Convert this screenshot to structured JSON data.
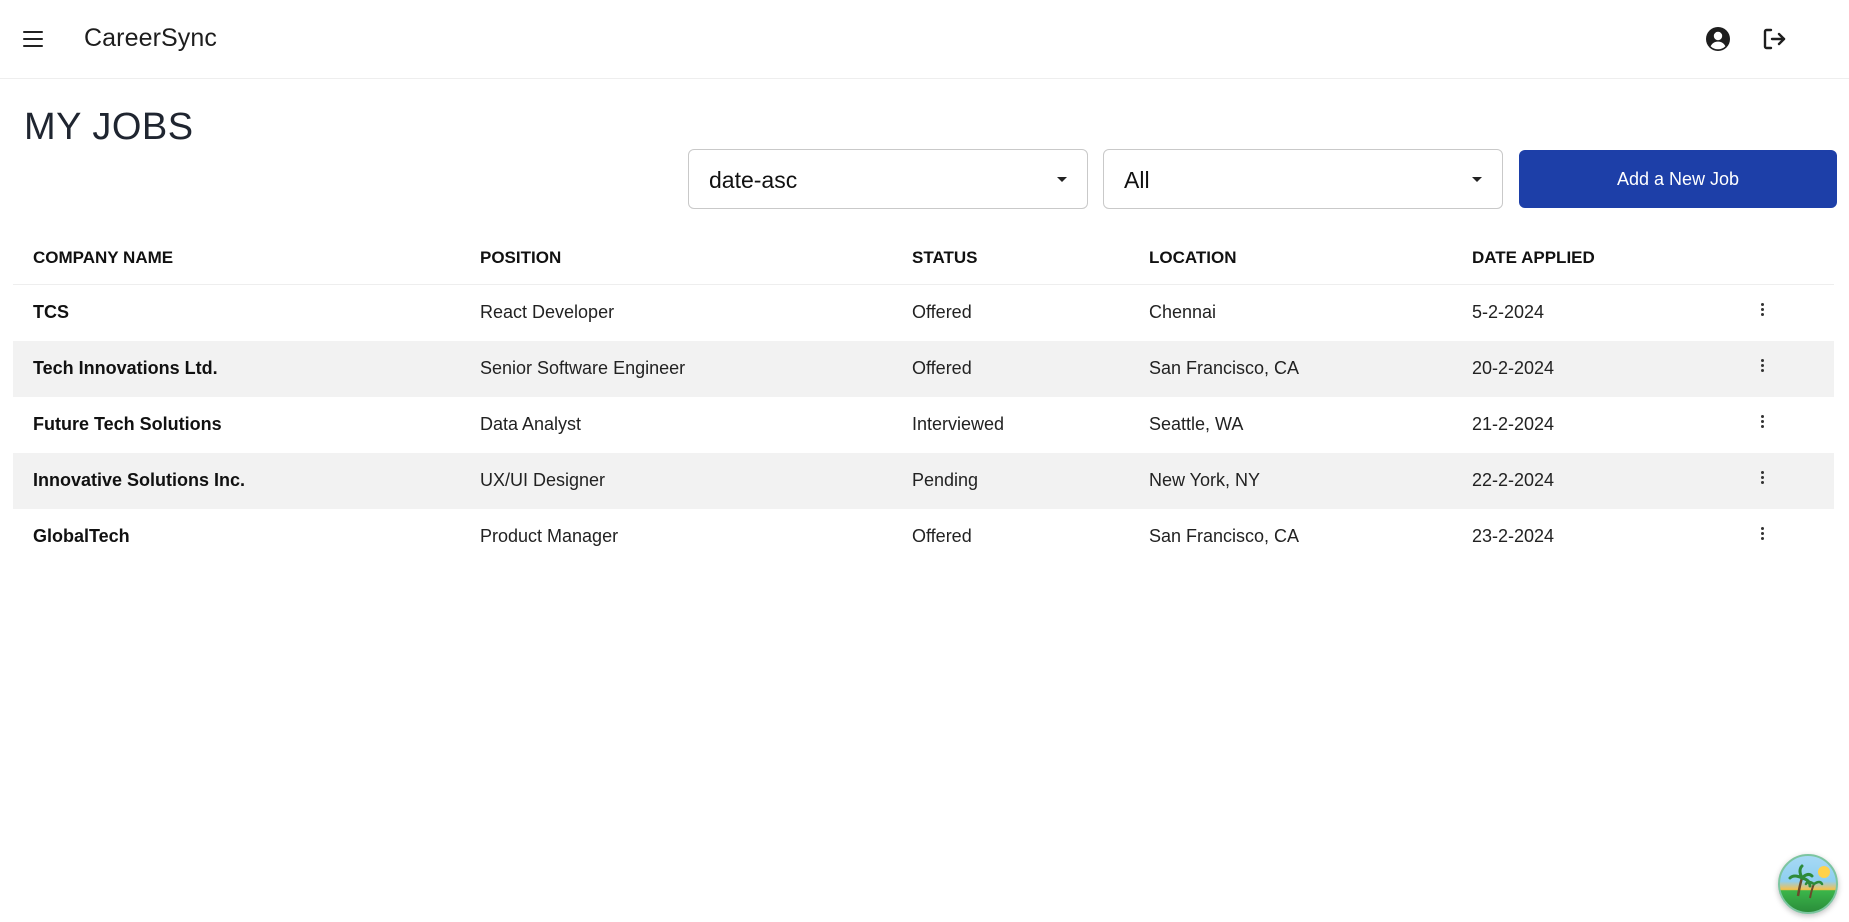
{
  "app": {
    "brand": "CareerSync",
    "icons": {
      "menu": "hamburger-menu-icon",
      "user": "user-circle-icon",
      "logout": "logout-icon"
    }
  },
  "page": {
    "title": "MY JOBS"
  },
  "controls": {
    "sort_value": "date-asc",
    "filter_value": "All",
    "add_button_label": "Add a New Job"
  },
  "table": {
    "headers": [
      "COMPANY NAME",
      "POSITION",
      "STATUS",
      "LOCATION",
      "DATE APPLIED"
    ],
    "rows": [
      {
        "company": "TCS",
        "position": "React Developer",
        "status": "Offered",
        "location": "Chennai",
        "date": "5-2-2024"
      },
      {
        "company": "Tech Innovations Ltd.",
        "position": "Senior Software Engineer",
        "status": "Offered",
        "location": "San Francisco, CA",
        "date": "20-2-2024"
      },
      {
        "company": "Future Tech Solutions",
        "position": "Data Analyst",
        "status": "Interviewed",
        "location": "Seattle, WA",
        "date": "21-2-2024"
      },
      {
        "company": "Innovative Solutions Inc.",
        "position": "UX/UI Designer",
        "status": "Pending",
        "location": "New York, NY",
        "date": "22-2-2024"
      },
      {
        "company": "GlobalTech",
        "position": "Product Manager",
        "status": "Offered",
        "location": "San Francisco, CA",
        "date": "23-2-2024"
      }
    ]
  },
  "colors": {
    "primary_button": "#1d3fa8",
    "stripe": "#f2f2f2",
    "title": "#1f2530"
  }
}
